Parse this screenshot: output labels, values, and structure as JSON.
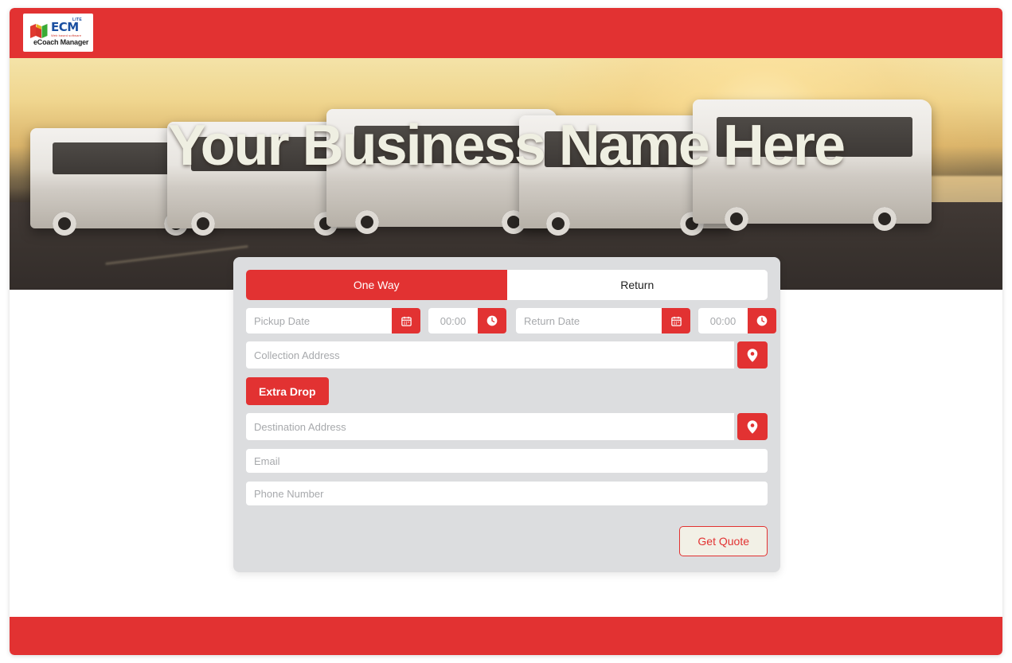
{
  "theme": {
    "brand_red": "#E23232",
    "panel_gray": "#DCDDDF",
    "hero_text_color": "#EFEFE2",
    "quote_button_bg": "#F2F0E6"
  },
  "header": {
    "logo": {
      "mark": "book-icon",
      "brand": "ECM",
      "badge": "LITE",
      "tagline": "Web based software",
      "product": "eCoach Manager"
    }
  },
  "hero": {
    "title": "Your Business Name Here",
    "image_description": "fleet of white minibuses parked on a road at sunset beside a lake"
  },
  "booking_form": {
    "tabs": [
      {
        "label": "One Way",
        "active": true
      },
      {
        "label": "Return",
        "active": false
      }
    ],
    "pickup": {
      "date_placeholder": "Pickup Date",
      "date_value": "",
      "calendar_icon": "calendar-icon",
      "time_placeholder": "00:00",
      "time_value": "",
      "clock_icon": "clock-icon"
    },
    "return": {
      "date_placeholder": "Return Date",
      "date_value": "",
      "calendar_icon": "calendar-icon",
      "time_placeholder": "00:00",
      "time_value": "",
      "clock_icon": "clock-icon"
    },
    "collection_address": {
      "placeholder": "Collection Address",
      "value": "",
      "pin_icon": "map-pin-icon"
    },
    "extra_drop_label": "Extra Drop",
    "destination_address": {
      "placeholder": "Destination Address",
      "value": "",
      "pin_icon": "map-pin-icon"
    },
    "email": {
      "placeholder": "Email",
      "value": ""
    },
    "phone": {
      "placeholder": "Phone Number",
      "value": ""
    },
    "submit_label": "Get Quote"
  },
  "footer": {}
}
